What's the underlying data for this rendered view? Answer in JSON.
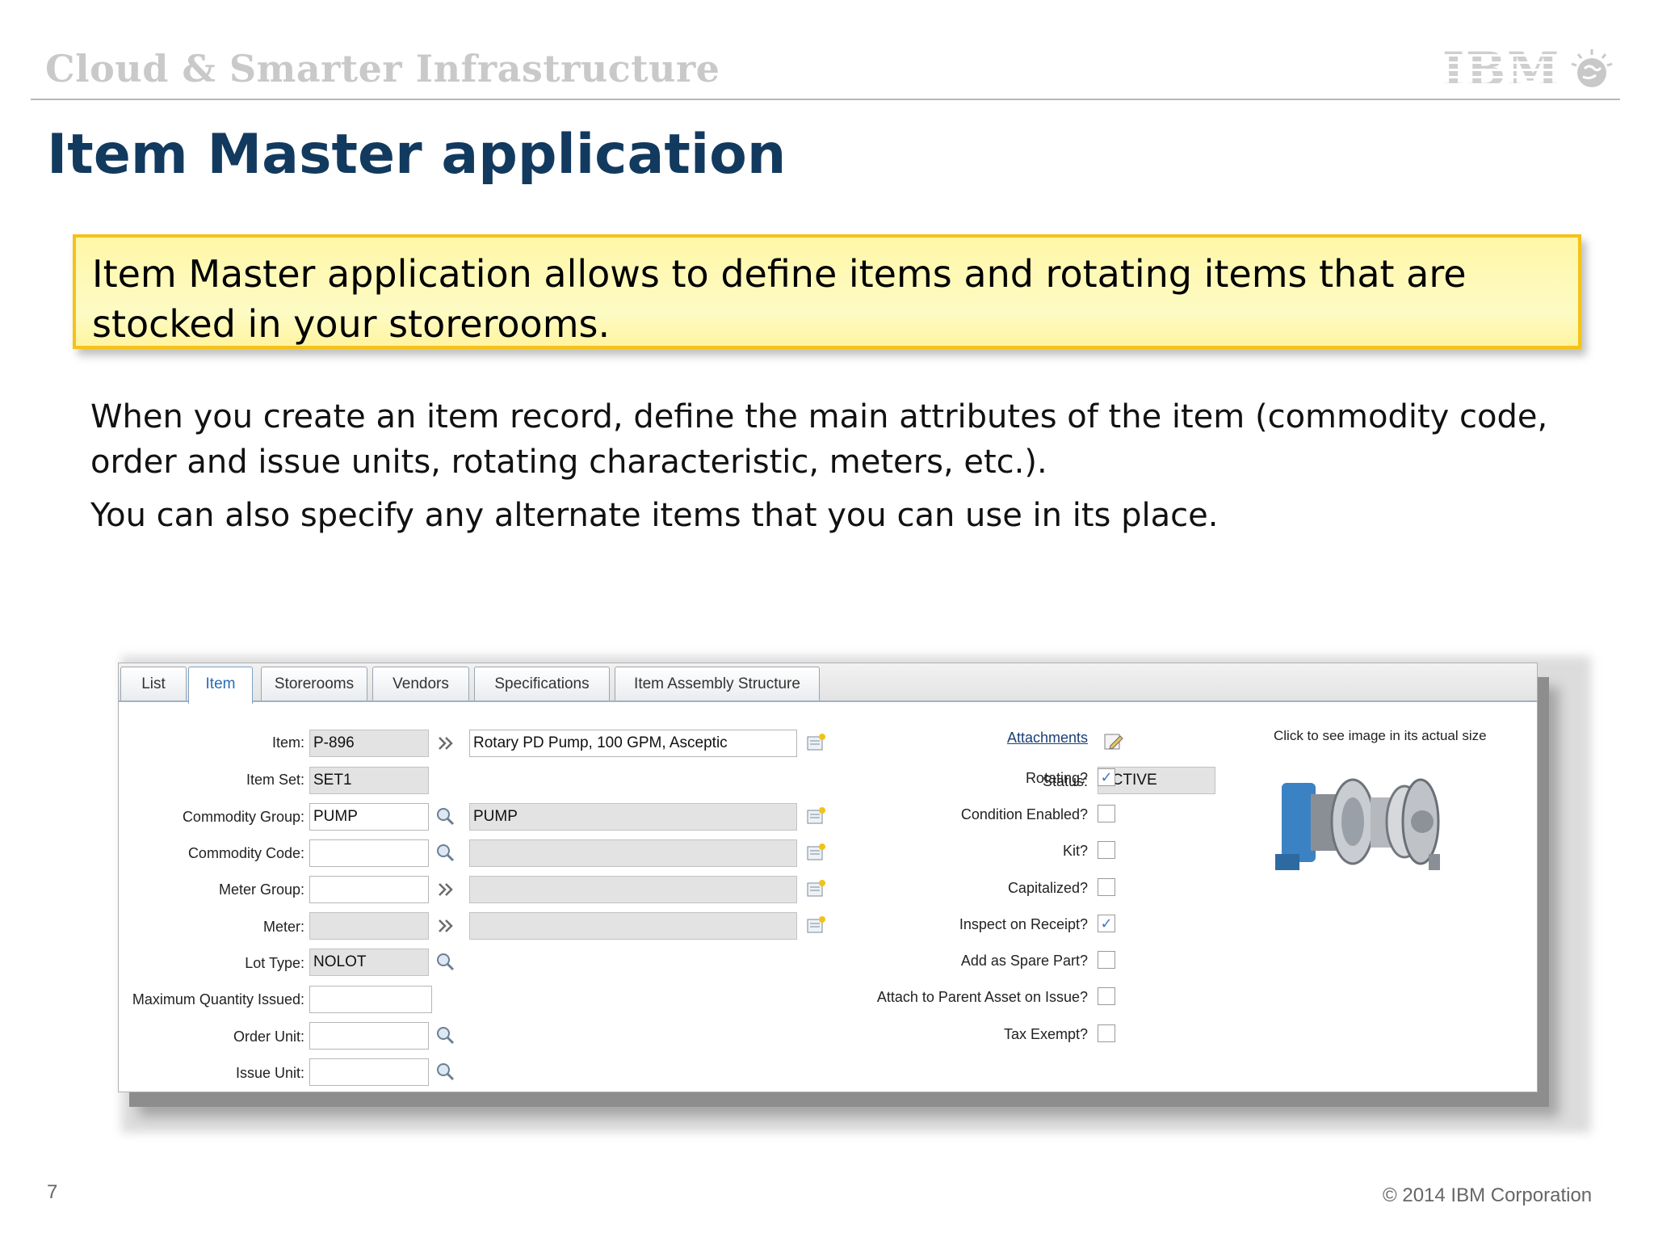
{
  "header": {
    "brand": "Cloud & Smarter Infrastructure",
    "logo_text": "IBM"
  },
  "slide": {
    "title": "Item Master application",
    "callout": "Item Master application allows to define items and rotating items that are stocked in your storerooms.",
    "paragraph1": "When you create an item record, define the main attributes of the item (commodity code, order and issue units, rotating characteristic, meters, etc.).",
    "paragraph2": "You can also specify any alternate items that you can use in its place.",
    "page_number": "7",
    "copyright": "© 2014 IBM Corporation"
  },
  "app": {
    "tabs": [
      "List",
      "Item",
      "Storerooms",
      "Vendors",
      "Specifications",
      "Item Assembly Structure"
    ],
    "active_tab": "Item",
    "left_fields": {
      "item_label": "Item:",
      "item_value": "P-896",
      "item_description": "Rotary PD Pump, 100 GPM, Asceptic",
      "item_set_label": "Item Set:",
      "item_set_value": "SET1",
      "commodity_group_label": "Commodity Group:",
      "commodity_group_value": "PUMP",
      "commodity_group_description": "PUMP",
      "commodity_code_label": "Commodity Code:",
      "commodity_code_value": "",
      "meter_group_label": "Meter Group:",
      "meter_group_value": "",
      "meter_label": "Meter:",
      "meter_value": "",
      "lot_type_label": "Lot Type:",
      "lot_type_value": "NOLOT",
      "max_qty_label": "Maximum Quantity Issued:",
      "max_qty_value": "",
      "order_unit_label": "Order Unit:",
      "order_unit_value": "",
      "issue_unit_label": "Issue Unit:",
      "issue_unit_value": ""
    },
    "right_fields": {
      "attachments_label": "Attachments",
      "status_label": "Status:",
      "status_value": "ACTIVE",
      "checkboxes": [
        {
          "label": "Rotating?",
          "checked": true
        },
        {
          "label": "Condition Enabled?",
          "checked": false
        },
        {
          "label": "Kit?",
          "checked": false
        },
        {
          "label": "Capitalized?",
          "checked": false
        },
        {
          "label": "Inspect on Receipt?",
          "checked": true
        },
        {
          "label": "Add as Spare Part?",
          "checked": false
        },
        {
          "label": "Attach to Parent Asset on Issue?",
          "checked": false
        },
        {
          "label": "Tax Exempt?",
          "checked": false
        }
      ],
      "image_caption": "Click to see image in its actual size"
    }
  },
  "colors": {
    "title": "#123a5f",
    "callout_bg": "#fdfbc4",
    "callout_border": "#f4c21a",
    "active_tab_text": "#2a6bb5"
  }
}
